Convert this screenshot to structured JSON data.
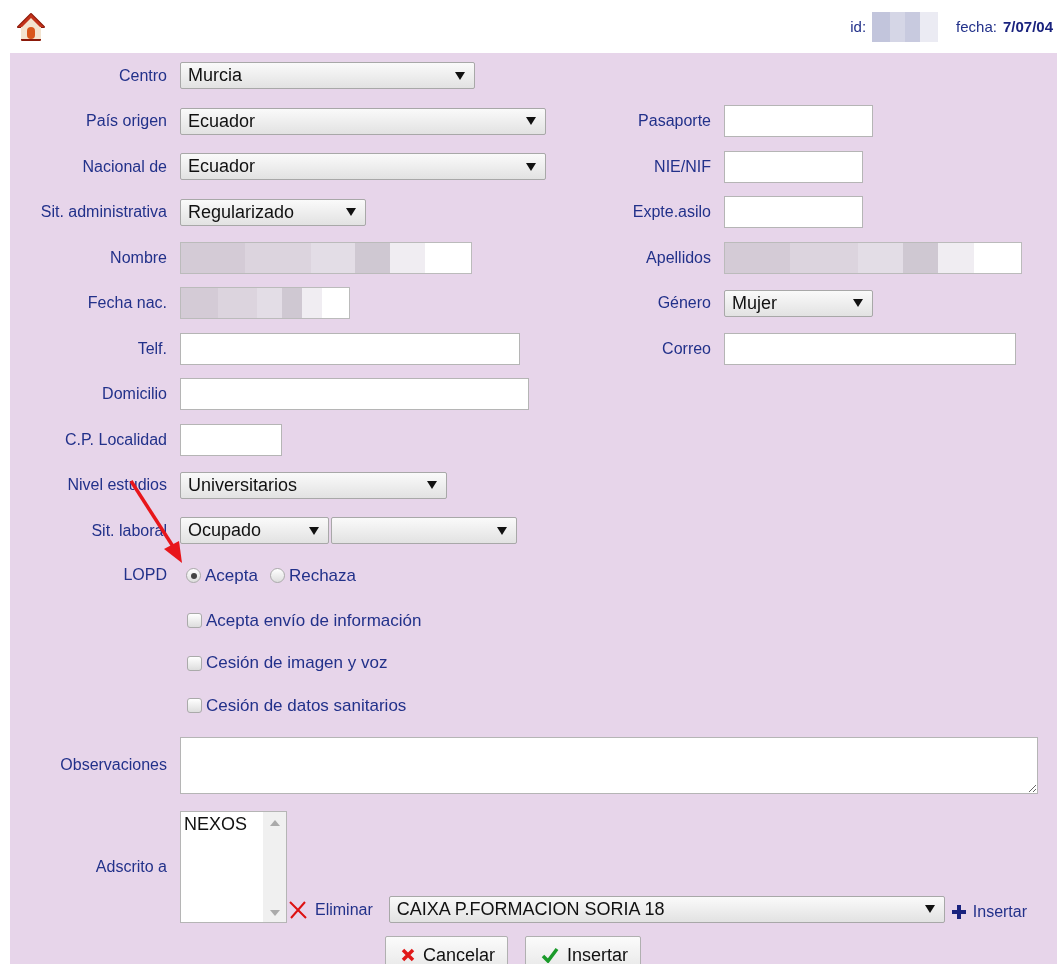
{
  "header": {
    "id_label": "id:",
    "date_label": "fecha:",
    "date": "7/07/04"
  },
  "rows": [
    {
      "left": {
        "label": "Centro",
        "kind": "select",
        "value": "Murcia"
      }
    },
    {
      "left": {
        "label": "País origen",
        "kind": "select",
        "value": "Ecuador"
      },
      "right": {
        "label": "Pasaporte",
        "kind": "input"
      }
    },
    {
      "left": {
        "label": "Nacional de",
        "kind": "select",
        "value": "Ecuador"
      },
      "right": {
        "label": "NIE/NIF",
        "kind": "input"
      }
    },
    {
      "left": {
        "label": "Sit. administrativa",
        "kind": "select",
        "value": "Regularizado"
      },
      "right": {
        "label": "Expte.asilo",
        "kind": "input"
      }
    },
    {
      "left": {
        "label": "Nombre",
        "kind": "redacted"
      },
      "right": {
        "label": "Apellidos",
        "kind": "redacted"
      }
    },
    {
      "left": {
        "label": "Fecha nac.",
        "kind": "redacted"
      },
      "right": {
        "label": "Género",
        "kind": "select",
        "value": "Mujer"
      }
    },
    {
      "left": {
        "label": "Telf.",
        "kind": "input"
      },
      "right": {
        "label": "Correo",
        "kind": "input"
      }
    },
    {
      "left": {
        "label": "Domicilio",
        "kind": "input"
      }
    },
    {
      "left": {
        "label": "C.P. Localidad",
        "kind": "input"
      }
    },
    {
      "left": {
        "label": "Nivel estudios",
        "kind": "select",
        "value": "Universitarios"
      }
    },
    {
      "left": {
        "label": "Sit. laboral",
        "kind": "select-pair",
        "value": "Ocupado"
      }
    }
  ],
  "lopd": {
    "label": "LOPD",
    "options": [
      {
        "label": "Acepta",
        "selected": true
      },
      {
        "label": "Rechaza",
        "selected": false
      }
    ]
  },
  "consents": [
    {
      "label": "Acepta envío de información",
      "checked": false
    },
    {
      "label": "Cesión de imagen y voz",
      "checked": false
    },
    {
      "label": "Cesión de datos sanitarios",
      "checked": false
    }
  ],
  "observaciones": {
    "label": "Observaciones"
  },
  "adscrito": {
    "label": "Adscrito a",
    "items": [
      "NEXOS"
    ],
    "remove": "Eliminar",
    "select": "CAIXA P.FORMACION SORIA 18",
    "add": "Insertar"
  },
  "buttons": [
    {
      "label": "Cancelar",
      "kind": "cancel"
    },
    {
      "label": "Insertar",
      "kind": "confirm"
    }
  ]
}
